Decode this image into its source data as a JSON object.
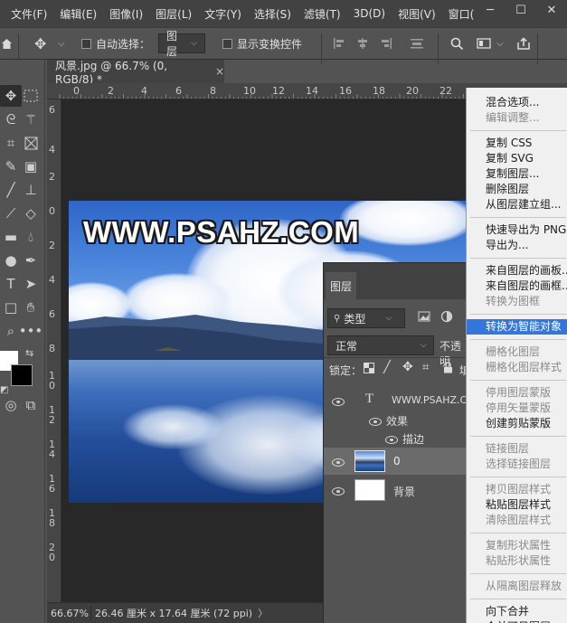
{
  "menu": {
    "items": [
      "文件(F)",
      "编辑(E)",
      "图像(I)",
      "图层(L)",
      "文字(Y)",
      "选择(S)",
      "滤镜(T)",
      "3D(D)",
      "视图(V)",
      "窗口(W"
    ]
  },
  "options_bar": {
    "auto_select_label": "自动选择：",
    "auto_select_target": "图层",
    "show_transform_label": "显示变换控件"
  },
  "document": {
    "tab_title": "风景.jpg @ 66.7% (0, RGB/8) *",
    "close_glyph": "×",
    "ruler_top_labels": [
      "0",
      "2",
      "4",
      "6",
      "8",
      "10",
      "12",
      "14",
      "16",
      "18",
      "20",
      "22"
    ],
    "ruler_left_labels": [
      "6",
      "4",
      "2",
      "0",
      "2",
      "4",
      "6",
      "8",
      "1\n0",
      "1\n2",
      "1\n4",
      "1\n6",
      "1\n8",
      "2\n0"
    ],
    "watermark_text": "WWW.PSAHZ.COM"
  },
  "status_bar": {
    "zoom": "66.67%",
    "dimensions": "26.46 厘米 x 17.64 厘米 (72 ppi)",
    "arrow": "〉"
  },
  "layers_panel": {
    "tab": "图层",
    "filter_kind": "类型",
    "blend_mode": "正常",
    "opacity_label": "不透明",
    "lock_label": "锁定：",
    "layers": [
      {
        "name": "WWW.PSAHZ.CO",
        "kind": "text"
      },
      {
        "name": "效果",
        "kind": "effects"
      },
      {
        "name": "描边",
        "kind": "effect"
      },
      {
        "name": "0",
        "kind": "image",
        "selected": true
      },
      {
        "name": "背景",
        "kind": "background"
      }
    ]
  },
  "context_menu": {
    "highlight_color": "#3377dd",
    "groups": [
      [
        {
          "label": "混合选项...",
          "enabled": true
        },
        {
          "label": "编辑调整...",
          "enabled": false
        }
      ],
      [
        {
          "label": "复制 CSS",
          "enabled": true
        },
        {
          "label": "复制 SVG",
          "enabled": true
        },
        {
          "label": "复制图层...",
          "enabled": true
        },
        {
          "label": "删除图层",
          "enabled": true
        },
        {
          "label": "从图层建立组...",
          "enabled": true
        }
      ],
      [
        {
          "label": "快速导出为 PNG",
          "enabled": true
        },
        {
          "label": "导出为...",
          "enabled": true
        }
      ],
      [
        {
          "label": "来自图层的画板...",
          "enabled": true
        },
        {
          "label": "来自图层的画框...",
          "enabled": true
        },
        {
          "label": "转换为图框",
          "enabled": false
        }
      ],
      [
        {
          "label": "转换为智能对象",
          "enabled": true,
          "highlighted": true
        }
      ],
      [
        {
          "label": "栅格化图层",
          "enabled": false
        },
        {
          "label": "栅格化图层样式",
          "enabled": false
        }
      ],
      [
        {
          "label": "停用图层蒙版",
          "enabled": false
        },
        {
          "label": "停用矢量蒙版",
          "enabled": false
        },
        {
          "label": "创建剪贴蒙版",
          "enabled": true
        }
      ],
      [
        {
          "label": "链接图层",
          "enabled": false
        },
        {
          "label": "选择链接图层",
          "enabled": false
        }
      ],
      [
        {
          "label": "拷贝图层样式",
          "enabled": false
        },
        {
          "label": "粘贴图层样式",
          "enabled": true
        },
        {
          "label": "清除图层样式",
          "enabled": false
        }
      ],
      [
        {
          "label": "复制形状属性",
          "enabled": false
        },
        {
          "label": "粘贴形状属性",
          "enabled": false
        }
      ],
      [
        {
          "label": "从隔离图层释放",
          "enabled": false
        }
      ],
      [
        {
          "label": "向下合并",
          "enabled": true
        },
        {
          "label": "合并可见图层",
          "enabled": true
        }
      ]
    ]
  }
}
